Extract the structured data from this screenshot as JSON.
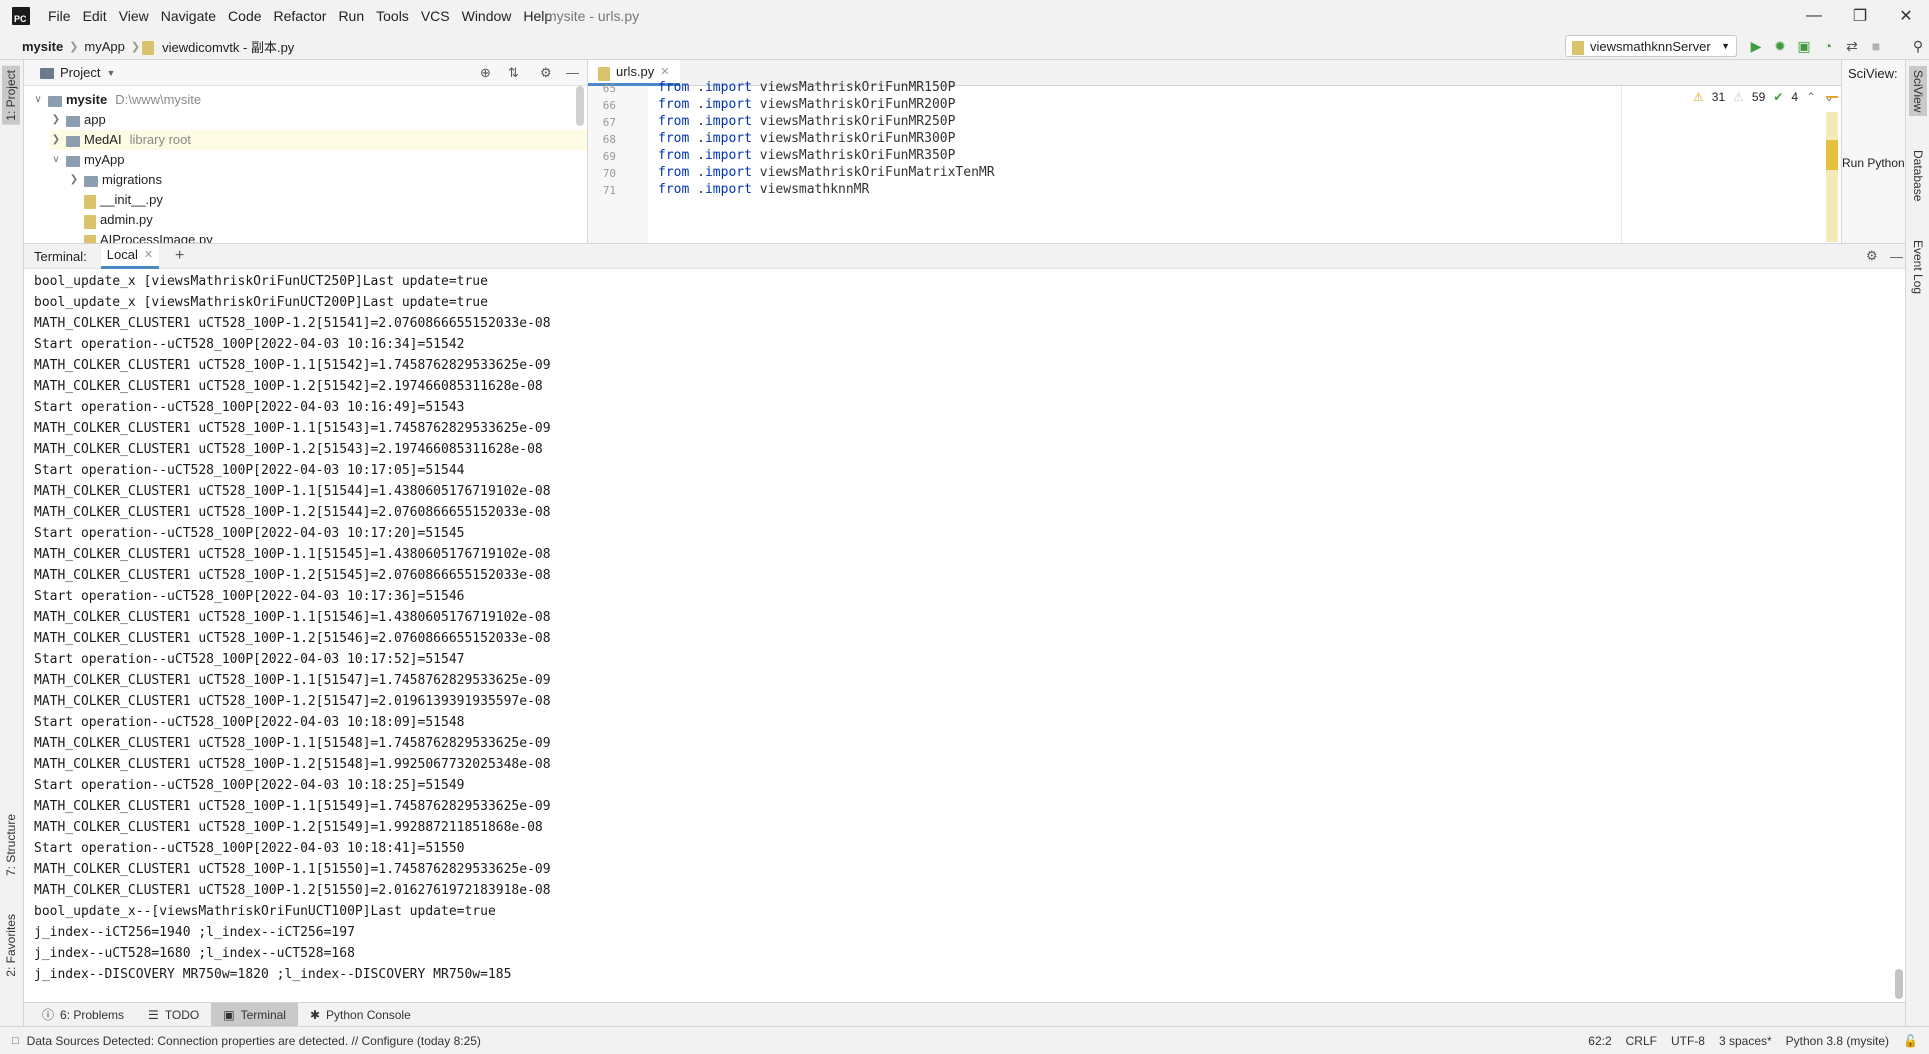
{
  "app": {
    "logo_text": "PC",
    "window_title": "mysite - urls.py",
    "menu": [
      "File",
      "Edit",
      "View",
      "Navigate",
      "Code",
      "Refactor",
      "Run",
      "Tools",
      "VCS",
      "Window",
      "Help"
    ]
  },
  "navbar": {
    "breadcrumb": [
      "mysite",
      "myApp",
      "viewdicomvtk - 副本.py"
    ],
    "run_config": "viewsmathknnServer"
  },
  "project": {
    "title": "Project",
    "tree": [
      {
        "label": "mysite",
        "note": "D:\\www\\mysite",
        "level": 0,
        "kind": "folder",
        "expanded": true
      },
      {
        "label": "app",
        "note": "",
        "level": 1,
        "kind": "folder",
        "expanded": false
      },
      {
        "label": "MedAI",
        "note": "library root",
        "level": 1,
        "kind": "folder",
        "expanded": false
      },
      {
        "label": "myApp",
        "note": "",
        "level": 1,
        "kind": "folder",
        "expanded": true
      },
      {
        "label": "migrations",
        "note": "",
        "level": 2,
        "kind": "folder",
        "expanded": false
      },
      {
        "label": "__init__.py",
        "note": "",
        "level": 2,
        "kind": "file"
      },
      {
        "label": "admin.py",
        "note": "",
        "level": 2,
        "kind": "file"
      },
      {
        "label": "AIProcessImage.py",
        "note": "",
        "level": 2,
        "kind": "file"
      }
    ]
  },
  "editor": {
    "tab_label": "urls.py",
    "inspection": {
      "warnings": "31",
      "weak_warnings": "59",
      "typos": "4"
    },
    "lines": [
      {
        "num": "65",
        "code": "from .import viewsMathriskOriFunMR150P"
      },
      {
        "num": "66",
        "code": "from .import viewsMathriskOriFunMR200P"
      },
      {
        "num": "67",
        "code": "from .import viewsMathriskOriFunMR250P"
      },
      {
        "num": "68",
        "code": "from .import viewsMathriskOriFunMR300P"
      },
      {
        "num": "69",
        "code": "from .import viewsMathriskOriFunMR350P"
      },
      {
        "num": "70",
        "code": "from .import viewsMathriskOriFunMatrixTenMR"
      },
      {
        "num": "71",
        "code": "from .import viewsmathknnMR"
      }
    ]
  },
  "sciview": {
    "title": "SciView:",
    "run_python": "Run Python"
  },
  "terminal": {
    "label": "Terminal:",
    "tab": "Local",
    "lines": [
      "bool_update_x [viewsMathriskOriFunUCT250P]Last update=true",
      "bool_update_x [viewsMathriskOriFunUCT200P]Last update=true",
      "MATH_COLKER_CLUSTER1 uCT528_100P-1.2[51541]=2.0760866655152033e-08",
      "Start operation--uCT528_100P[2022-04-03 10:16:34]=51542",
      "MATH_COLKER_CLUSTER1 uCT528_100P-1.1[51542]=1.7458762829533625e-09",
      "MATH_COLKER_CLUSTER1 uCT528_100P-1.2[51542]=2.197466085311628e-08",
      "Start operation--uCT528_100P[2022-04-03 10:16:49]=51543",
      "MATH_COLKER_CLUSTER1 uCT528_100P-1.1[51543]=1.7458762829533625e-09",
      "MATH_COLKER_CLUSTER1 uCT528_100P-1.2[51543]=2.197466085311628e-08",
      "Start operation--uCT528_100P[2022-04-03 10:17:05]=51544",
      "MATH_COLKER_CLUSTER1 uCT528_100P-1.1[51544]=1.4380605176719102e-08",
      "MATH_COLKER_CLUSTER1 uCT528_100P-1.2[51544]=2.0760866655152033e-08",
      "Start operation--uCT528_100P[2022-04-03 10:17:20]=51545",
      "MATH_COLKER_CLUSTER1 uCT528_100P-1.1[51545]=1.4380605176719102e-08",
      "MATH_COLKER_CLUSTER1 uCT528_100P-1.2[51545]=2.0760866655152033e-08",
      "Start operation--uCT528_100P[2022-04-03 10:17:36]=51546",
      "MATH_COLKER_CLUSTER1 uCT528_100P-1.1[51546]=1.4380605176719102e-08",
      "MATH_COLKER_CLUSTER1 uCT528_100P-1.2[51546]=2.0760866655152033e-08",
      "Start operation--uCT528_100P[2022-04-03 10:17:52]=51547",
      "MATH_COLKER_CLUSTER1 uCT528_100P-1.1[51547]=1.7458762829533625e-09",
      "MATH_COLKER_CLUSTER1 uCT528_100P-1.2[51547]=2.0196139391935597e-08",
      "Start operation--uCT528_100P[2022-04-03 10:18:09]=51548",
      "MATH_COLKER_CLUSTER1 uCT528_100P-1.1[51548]=1.7458762829533625e-09",
      "MATH_COLKER_CLUSTER1 uCT528_100P-1.2[51548]=1.9925067732025348e-08",
      "Start operation--uCT528_100P[2022-04-03 10:18:25]=51549",
      "MATH_COLKER_CLUSTER1 uCT528_100P-1.1[51549]=1.7458762829533625e-09",
      "MATH_COLKER_CLUSTER1 uCT528_100P-1.2[51549]=1.992887211851868e-08",
      "Start operation--uCT528_100P[2022-04-03 10:18:41]=51550",
      "MATH_COLKER_CLUSTER1 uCT528_100P-1.1[51550]=1.7458762829533625e-09",
      "MATH_COLKER_CLUSTER1 uCT528_100P-1.2[51550]=2.0162761972183918e-08",
      "bool_update_x--[viewsMathriskOriFunUCT100P]Last update=true",
      "j_index--iCT256=1940 ;l_index--iCT256=197",
      "j_index--uCT528=1680 ;l_index--uCT528=168",
      "j_index--DISCOVERY MR750w=1820 ;l_index--DISCOVERY MR750w=185"
    ]
  },
  "left_tools": {
    "project": "1: Project",
    "structure": "7: Structure",
    "favorites": "2: Favorites"
  },
  "right_tools": {
    "sciview": "SciView",
    "database": "Database",
    "event_log": "Event Log"
  },
  "bottom_tools": [
    {
      "label": "6: Problems",
      "icon": "problems-icon",
      "active": false
    },
    {
      "label": "TODO",
      "icon": "todo-icon",
      "active": false
    },
    {
      "label": "Terminal",
      "icon": "terminal-icon",
      "active": true
    },
    {
      "label": "Python Console",
      "icon": "python-console-icon",
      "active": false
    }
  ],
  "statusbar": {
    "message": "Data Sources Detected: Connection properties are detected. // Configure (today 8:25)",
    "position": "62:2",
    "line_sep": "CRLF",
    "encoding": "UTF-8",
    "indent": "3 spaces*",
    "interpreter": "Python 3.8 (mysite)"
  },
  "colors": {
    "accent": "#4a88c7",
    "run_green": "#3d9c3d",
    "warning": "#e0a526"
  }
}
